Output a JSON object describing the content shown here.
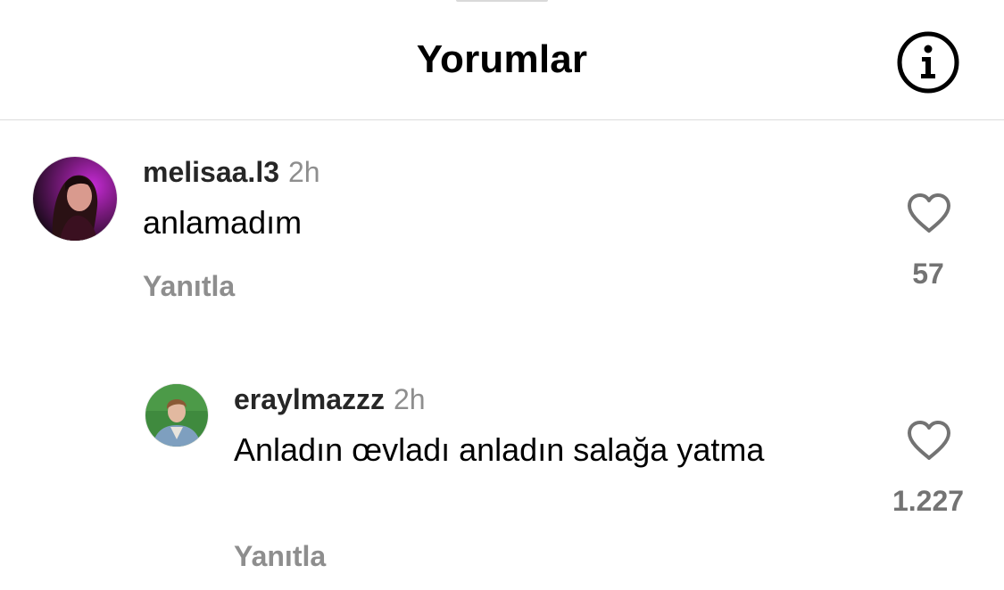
{
  "header": {
    "title": "Yorumlar",
    "info_icon": "info-circle-icon"
  },
  "comments": [
    {
      "username": "melisaa.l3",
      "time": "2h",
      "text": "anlamadım",
      "reply_label": "Yanıtla",
      "like_count": "57",
      "avatar_icon": "user-avatar-photo"
    },
    {
      "username": "eraylmazzz",
      "time": "2h",
      "text": "Anladın œvladı anladın salağa yatma",
      "reply_label": "Yanıtla",
      "like_count": "1.227",
      "avatar_icon": "user-avatar-photo"
    }
  ],
  "colors": {
    "secondary_text": "#8e8e8e",
    "like_count": "#737373",
    "divider": "#dbdbdb"
  }
}
